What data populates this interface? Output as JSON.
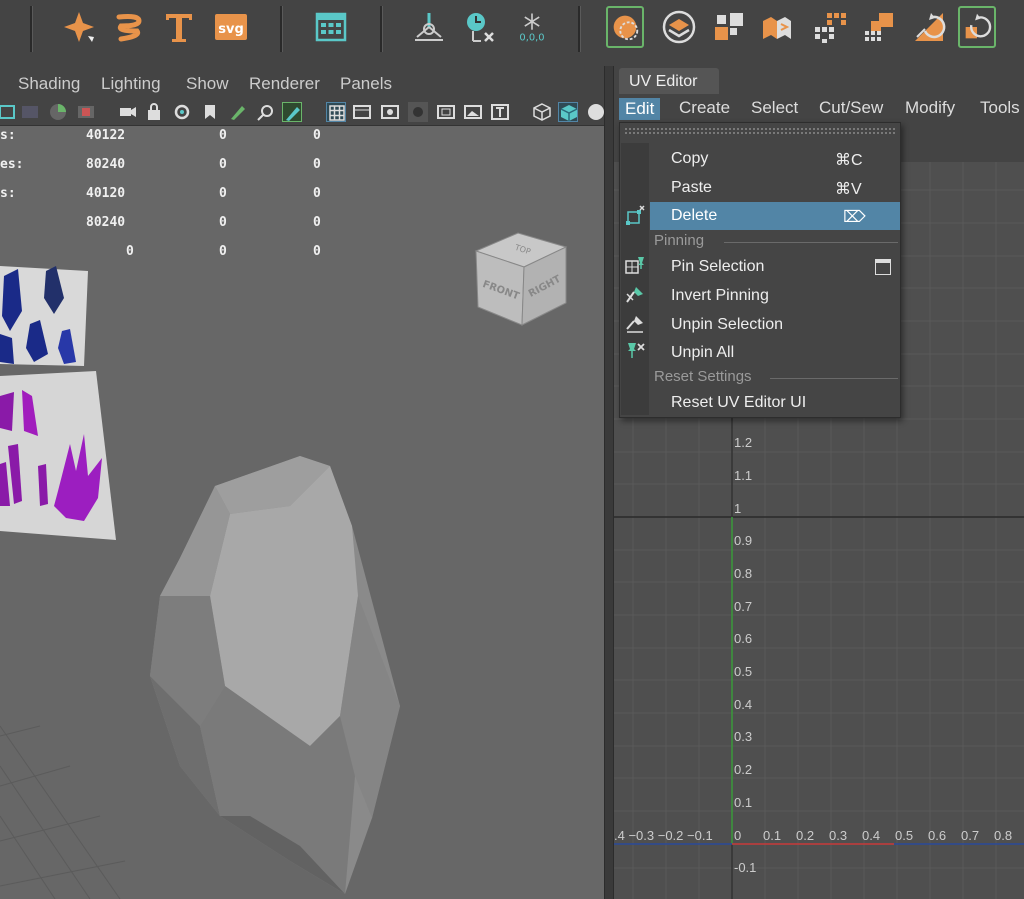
{
  "viewport": {
    "menu": [
      "Shading",
      "Lighting",
      "Show",
      "Renderer",
      "Panels"
    ],
    "hud": [
      {
        "label": "s:",
        "values": [
          "40122",
          "0",
          "0"
        ]
      },
      {
        "label": "es:",
        "values": [
          "80240",
          "0",
          "0"
        ]
      },
      {
        "label": "s:",
        "values": [
          "40120",
          "0",
          "0"
        ]
      },
      {
        "label": "",
        "values": [
          "80240",
          "0",
          "0"
        ]
      },
      {
        "label": "",
        "values": [
          "0",
          "0",
          "0"
        ]
      }
    ],
    "view_cube": {
      "top": "TOP",
      "front": "FRONT",
      "right": "RIGHT"
    }
  },
  "shelf": {
    "svg_label": "svg",
    "snap_readout": "0,0,0"
  },
  "uv_editor": {
    "tab_title": "UV Editor",
    "menu": [
      "Edit",
      "Create",
      "Select",
      "Cut/Sew",
      "Modify",
      "Tools"
    ],
    "v_axis": [
      "1.2",
      "1.1",
      "1",
      "0.9",
      "0.8",
      "0.7",
      "0.6",
      "0.5",
      "0.4",
      "0.3",
      "0.2",
      "0.1",
      "-0.1"
    ],
    "u_axis_neg": ".4 −0.3 −0.2 −0.1",
    "u_axis_pos": [
      "0",
      "0.1",
      "0.2",
      "0.3",
      "0.4",
      "0.5",
      "0.6",
      "0.7",
      "0.8"
    ]
  },
  "edit_menu": {
    "items": {
      "copy": {
        "label": "Copy",
        "shortcut": "⌘C"
      },
      "paste": {
        "label": "Paste",
        "shortcut": "⌘V"
      },
      "delete": {
        "label": "Delete",
        "shortcut": "⌦"
      },
      "pin_selection": {
        "label": "Pin Selection"
      },
      "invert_pinning": {
        "label": "Invert Pinning"
      },
      "unpin_selection": {
        "label": "Unpin Selection"
      },
      "unpin_all": {
        "label": "Unpin All"
      },
      "reset_ui": {
        "label": "Reset UV Editor UI"
      }
    },
    "sections": {
      "pinning": "Pinning",
      "reset": "Reset Settings"
    }
  },
  "colors": {
    "accent": "#5285a6",
    "orange": "#e8934a",
    "green": "#6ab56a",
    "teal": "#5ac8c8"
  }
}
